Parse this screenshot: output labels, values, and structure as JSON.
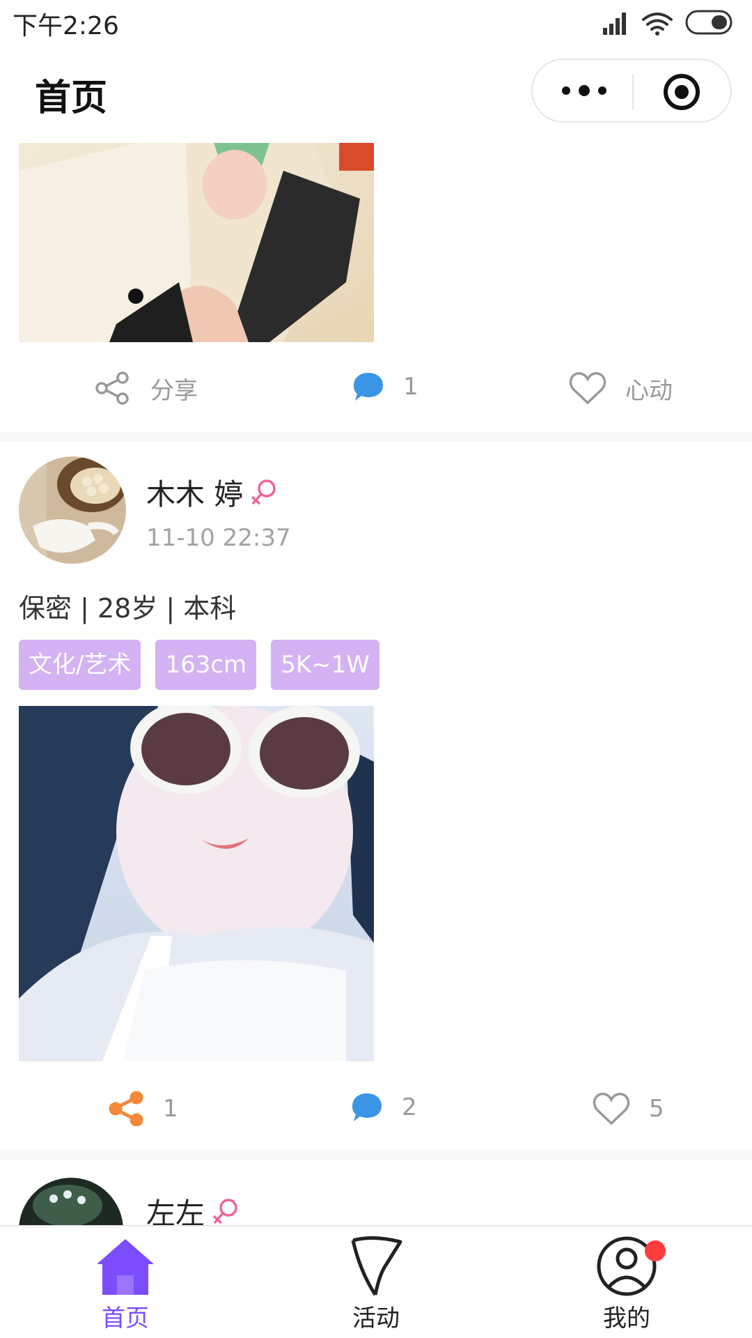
{
  "status_bar": {
    "time": "下午2:26"
  },
  "nav": {
    "title": "首页",
    "more_icon": "more-dots-icon",
    "target_icon": "target-icon"
  },
  "post1": {
    "actions": {
      "share_label": "分享",
      "comment_count": "1",
      "like_label": "心动"
    }
  },
  "post2": {
    "user_name": "木木 婷",
    "time": "11-10 22:37",
    "info": "保密 | 28岁 | 本科",
    "tags": [
      "文化/艺术",
      "163cm",
      "5K~1W"
    ],
    "actions": {
      "share_count": "1",
      "comment_count": "2",
      "like_count": "5"
    }
  },
  "post3": {
    "user_name": "左左"
  },
  "tabbar": {
    "items": [
      {
        "label": "首页",
        "icon": "home-icon"
      },
      {
        "label": "活动",
        "icon": "flag-icon"
      },
      {
        "label": "我的",
        "icon": "user-icon"
      }
    ]
  },
  "colors": {
    "accent": "#7b4dff",
    "tag_bg": "#d4b2f3",
    "comment_blue": "#3a95e6",
    "share_orange": "#f4893a",
    "female_pink": "#f0649a",
    "badge_red": "#ff3b3b"
  }
}
